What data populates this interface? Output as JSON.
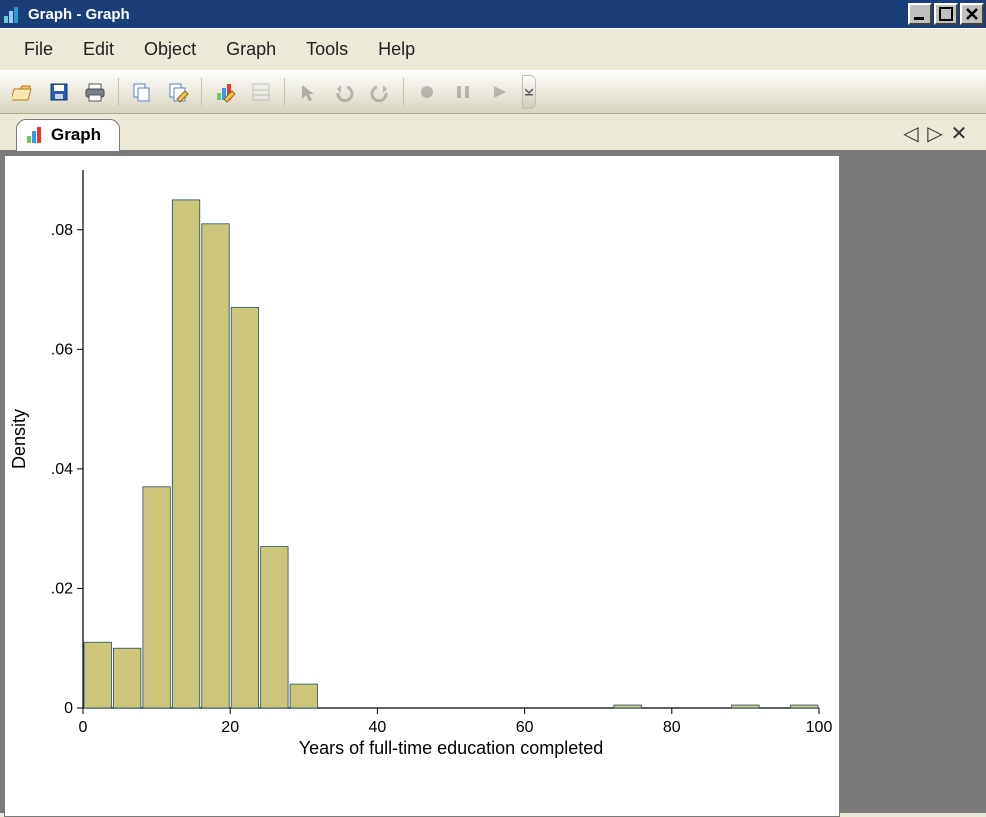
{
  "window": {
    "title": "Graph - Graph"
  },
  "menu": {
    "items": [
      "File",
      "Edit",
      "Object",
      "Graph",
      "Tools",
      "Help"
    ]
  },
  "toolbar": {
    "icons": [
      "open-icon",
      "save-icon",
      "print-icon",
      "sep",
      "copy-icon",
      "rename-icon",
      "sep",
      "edit-graph-icon",
      "properties-icon",
      "sep",
      "select-icon",
      "undo-icon",
      "redo-icon",
      "sep",
      "record-icon",
      "pause-icon",
      "play-icon"
    ]
  },
  "tabs": {
    "active": {
      "label": "Graph"
    },
    "nav": {
      "prev": "◁",
      "next": "▷",
      "close": "✕"
    }
  },
  "chart_data": {
    "type": "bar",
    "xlabel": "Years of full-time education completed",
    "ylabel": "Density",
    "xlim": [
      0,
      100
    ],
    "ylim": [
      0,
      0.09
    ],
    "x_ticks": [
      0,
      20,
      40,
      60,
      80,
      100
    ],
    "y_ticks": [
      0,
      0.02,
      0.04,
      0.06,
      0.08
    ],
    "y_tick_labels": [
      "0",
      ".02",
      ".04",
      ".06",
      ".08"
    ],
    "bin_width": 4,
    "bins_start": [
      0,
      4,
      8,
      12,
      16,
      20,
      24,
      28,
      72,
      88,
      96
    ],
    "values": [
      0.011,
      0.01,
      0.037,
      0.085,
      0.081,
      0.067,
      0.027,
      0.004,
      0.0005,
      0.0005,
      0.0005
    ],
    "bar_fill": "#ccc57a",
    "bar_stroke": "#1f4e6b"
  }
}
